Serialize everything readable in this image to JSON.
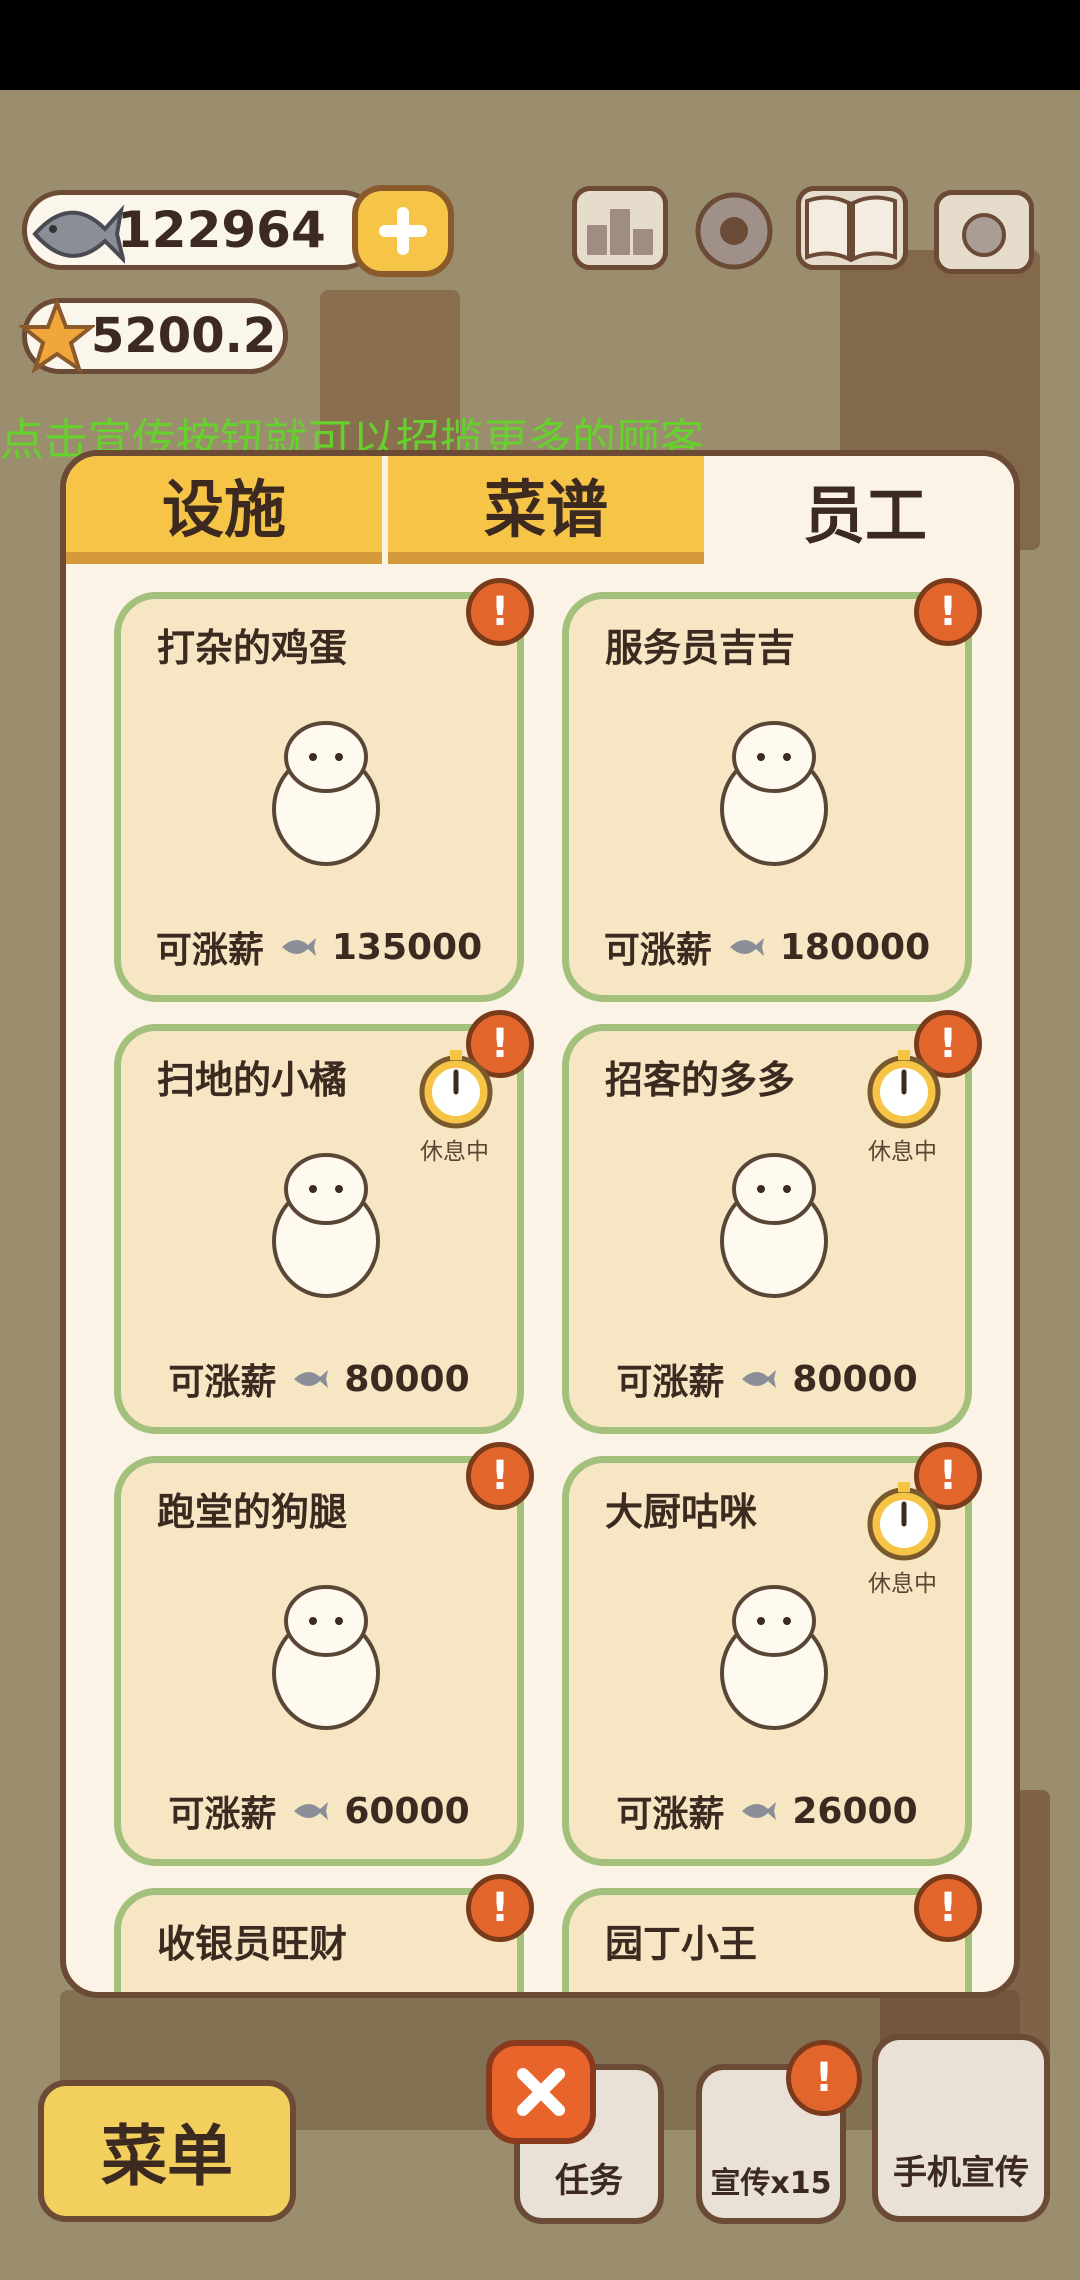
{
  "currency": {
    "fish": "122964",
    "stars": "5200.2"
  },
  "marquee_text": "点击宣传按钮就可以招揽更多的顾客",
  "tabs": [
    {
      "label": "设施",
      "active": false
    },
    {
      "label": "菜谱",
      "active": false
    },
    {
      "label": "员工",
      "active": true
    }
  ],
  "salary_prefix": "可涨薪",
  "rest_label": "休息中",
  "staff": [
    {
      "name": "打杂的鸡蛋",
      "salary": "135000",
      "resting": false
    },
    {
      "name": "服务员吉吉",
      "salary": "180000",
      "resting": false
    },
    {
      "name": "扫地的小橘",
      "salary": "80000",
      "resting": true
    },
    {
      "name": "招客的多多",
      "salary": "80000",
      "resting": true
    },
    {
      "name": "跑堂的狗腿",
      "salary": "60000",
      "resting": false
    },
    {
      "name": "大厨咕咪",
      "salary": "26000",
      "resting": true
    },
    {
      "name": "收银员旺财",
      "salary": "",
      "resting": false
    },
    {
      "name": "园丁小王",
      "salary": "",
      "resting": false
    }
  ],
  "bottom": {
    "menu": "菜单",
    "tasks": "任务",
    "promo": "宣传x15",
    "phone_promo": "手机宣传"
  },
  "colors": {
    "accent": "#f6c548",
    "card_border": "#a3c07c",
    "alert": "#e2652c",
    "close": "#e8642a"
  }
}
